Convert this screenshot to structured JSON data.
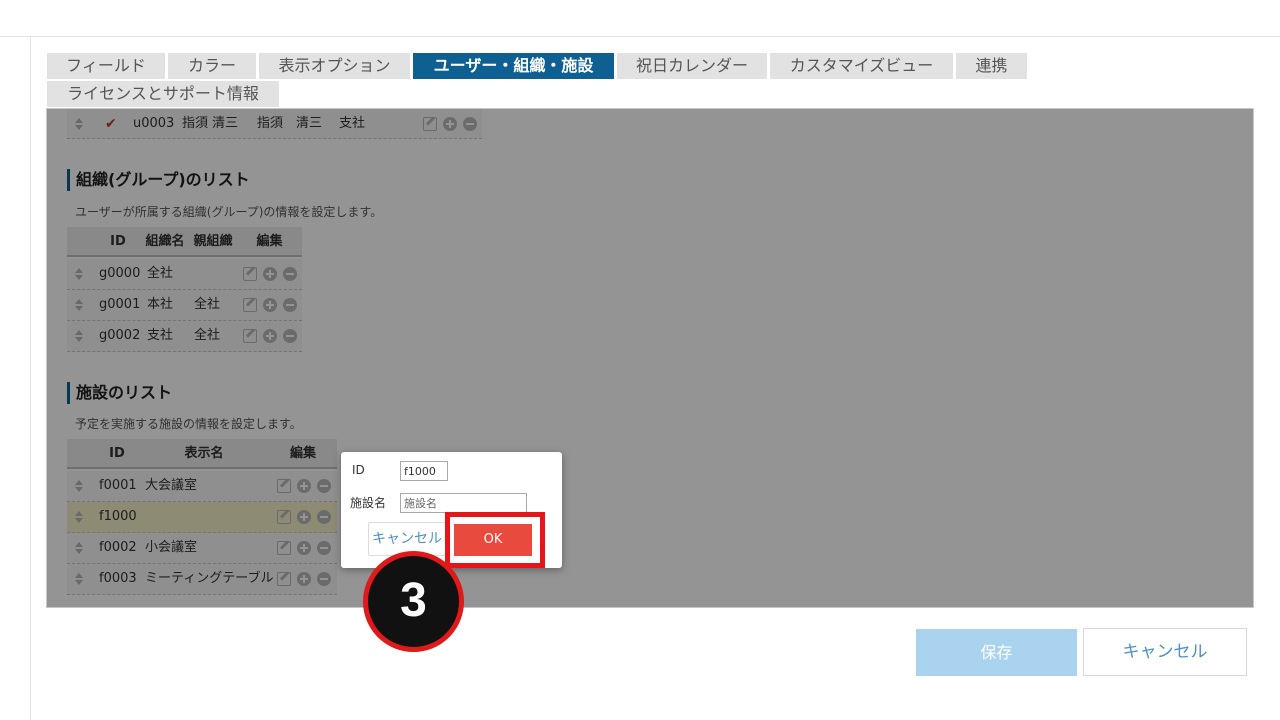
{
  "tabs": [
    {
      "label": "フィールド"
    },
    {
      "label": "カラー"
    },
    {
      "label": "表示オプション"
    },
    {
      "label": "ユーザー・組織・施設",
      "active": true
    },
    {
      "label": "祝日カレンダー"
    },
    {
      "label": "カスタマイズビュー"
    },
    {
      "label": "連携"
    },
    {
      "label": "ライセンスとサポート情報"
    }
  ],
  "user_row": {
    "id": "u0003",
    "name1": "指須 清三",
    "name2": "指須　清三",
    "org": "支社"
  },
  "org_section": {
    "title": "組織(グループ)のリスト",
    "desc": "ユーザーが所属する組織(グループ)の情報を設定します。",
    "headers": {
      "id": "ID",
      "name": "組織名",
      "parent": "親組織",
      "edit": "編集"
    },
    "rows": [
      {
        "id": "g0000",
        "name": "全社",
        "parent": ""
      },
      {
        "id": "g0001",
        "name": "本社",
        "parent": "全社"
      },
      {
        "id": "g0002",
        "name": "支社",
        "parent": "全社"
      }
    ]
  },
  "facility_section": {
    "title": "施設のリスト",
    "desc": "予定を実施する施設の情報を設定します。",
    "headers": {
      "id": "ID",
      "name": "表示名",
      "edit": "編集"
    },
    "rows": [
      {
        "id": "f0001",
        "name": "大会議室"
      },
      {
        "id": "f1000",
        "name": ""
      },
      {
        "id": "f0002",
        "name": "小会議室"
      },
      {
        "id": "f0003",
        "name": "ミーティングテーブル"
      }
    ]
  },
  "dialog": {
    "id_label": "ID",
    "id_value": "f1000",
    "name_label": "施設名",
    "name_placeholder": "施設名",
    "cancel_label": "キャンセル",
    "ok_label": "OK"
  },
  "step_badge": "3",
  "footer": {
    "save_label": "保存",
    "cancel_label": "キャンセル"
  },
  "colors": {
    "accent": "#0e5f92",
    "ok": "#e84a3e",
    "highlight": "#e5161a",
    "save": "#a9d3ee"
  }
}
